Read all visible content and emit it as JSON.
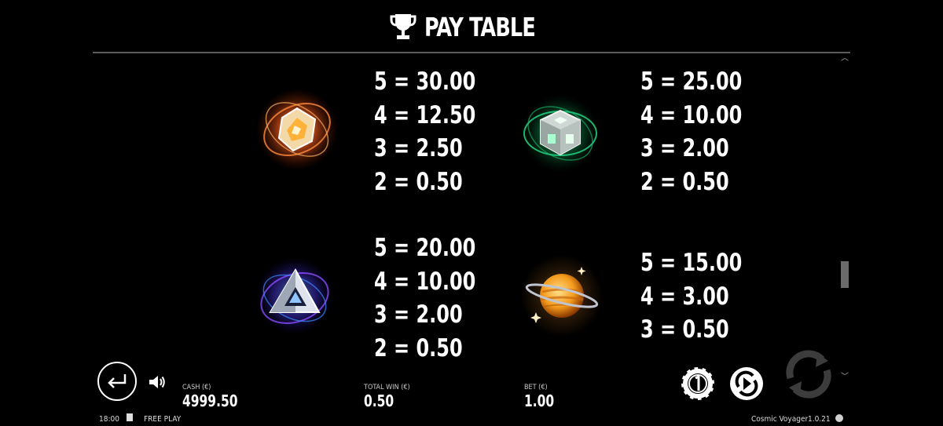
{
  "header": {
    "title": "PAY TABLE",
    "icon": "trophy-icon"
  },
  "symbols": [
    {
      "name": "Orange crystal",
      "icon": "orange-crystal-icon",
      "payouts": [
        "5 = 30.00",
        "4 = 12.50",
        "3 = 2.50",
        "2 = 0.50"
      ]
    },
    {
      "name": "Green cube",
      "icon": "green-cube-icon",
      "payouts": [
        "5 = 25.00",
        "4 = 10.00",
        "3 = 2.00",
        "2 = 0.50"
      ]
    },
    {
      "name": "Blue pyramid",
      "icon": "blue-pyramid-icon",
      "payouts": [
        "5 = 20.00",
        "4 = 10.00",
        "3 = 2.00",
        "2 = 0.50"
      ]
    },
    {
      "name": "Orange planet",
      "icon": "orange-planet-icon",
      "payouts": [
        "5 = 15.00",
        "4 = 3.00",
        "3 = 0.50"
      ]
    }
  ],
  "footer": {
    "cash_label": "CASH (€)",
    "cash_value": "4999.50",
    "total_win_label": "TOTAL WIN (€)",
    "total_win_value": "0.50",
    "bet_label": "BET (€)",
    "bet_value": "1.00"
  },
  "status_bar": {
    "time": "18:00",
    "mode": "FREE PLAY",
    "game_name": "Cosmic Voyager",
    "version": "1.0.21"
  },
  "colors": {
    "background": "#000000",
    "text": "#ffffff",
    "divider": "#5b5b5b"
  }
}
